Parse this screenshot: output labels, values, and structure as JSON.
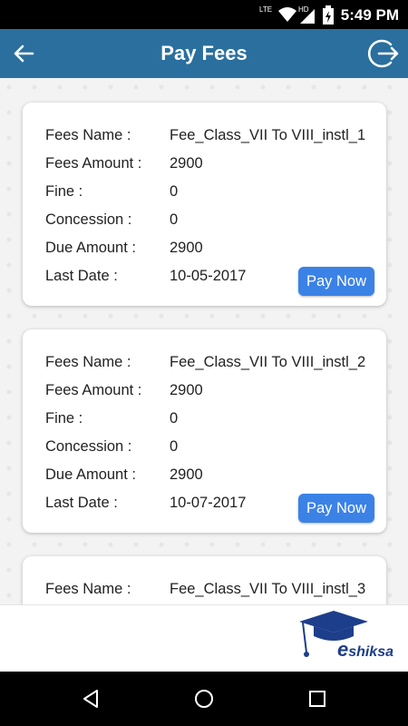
{
  "status": {
    "time": "5:49 PM",
    "network": "LTE",
    "hd": "HD"
  },
  "header": {
    "title": "Pay Fees"
  },
  "labels": {
    "fees_name": "Fees Name :",
    "fees_amount": "Fees Amount :",
    "fine": "Fine :",
    "concession": "Concession :",
    "due_amount": "Due Amount :",
    "last_date": "Last Date :",
    "pay_now": "Pay Now"
  },
  "fees": [
    {
      "name": "Fee_Class_VII To VIII_instl_1",
      "amount": "2900",
      "fine": "0",
      "concession": "0",
      "due": "2900",
      "last_date": "10-05-2017"
    },
    {
      "name": "Fee_Class_VII To VIII_instl_2",
      "amount": "2900",
      "fine": "0",
      "concession": "0",
      "due": "2900",
      "last_date": "10-07-2017"
    },
    {
      "name": "Fee_Class_VII To VIII_instl_3"
    }
  ],
  "brand": {
    "e": "e",
    "rest": "shiksa"
  },
  "colors": {
    "app_bar": "#2a6f9e",
    "button": "#3b82e6",
    "brand": "#1d3e8a"
  },
  "icons": [
    "back-arrow-icon",
    "logout-icon",
    "wifi-icon",
    "signal-icon",
    "battery-icon",
    "nav-back-icon",
    "nav-home-icon",
    "nav-recents-icon"
  ]
}
